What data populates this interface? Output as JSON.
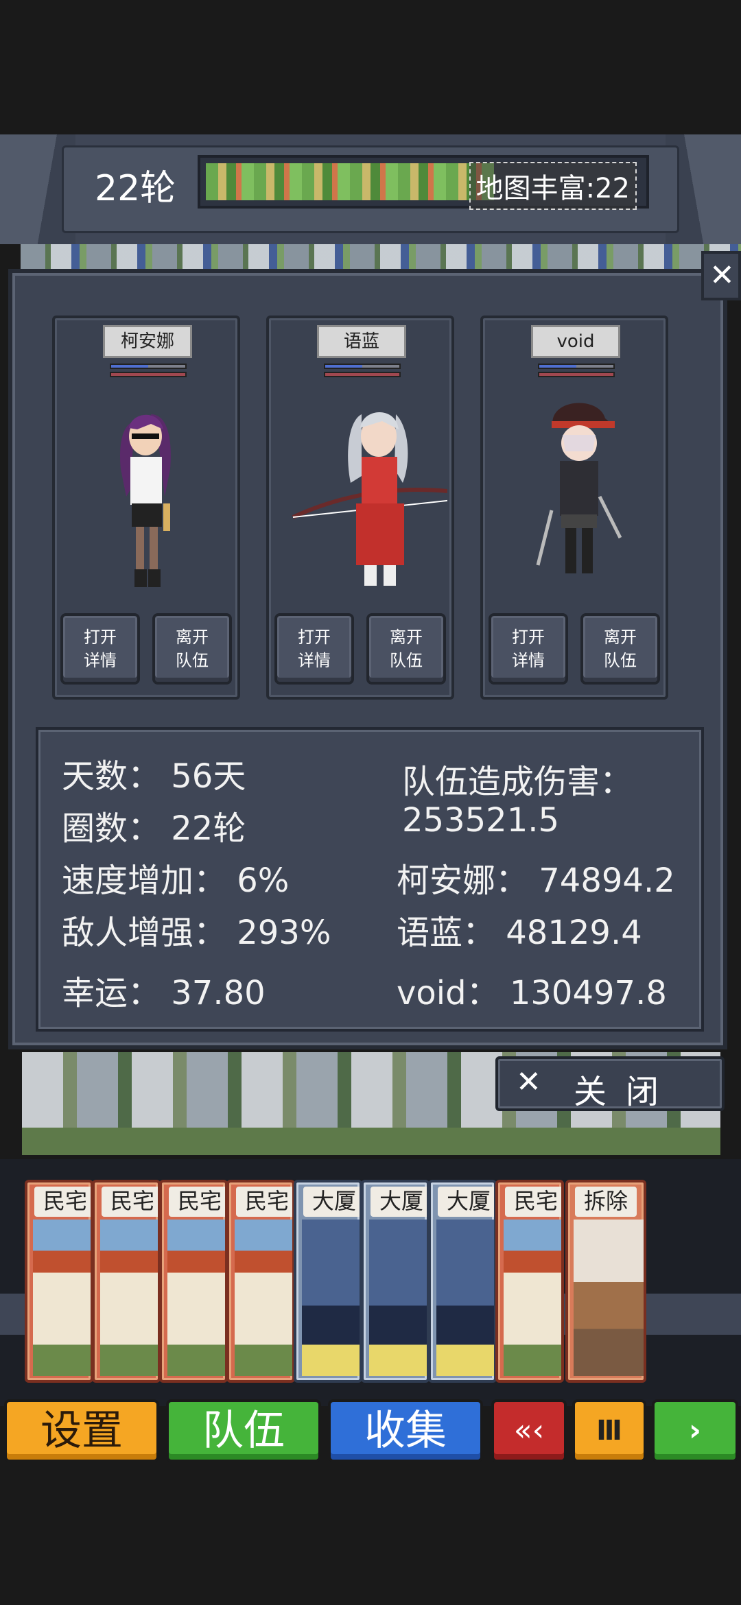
{
  "header": {
    "round": "22轮",
    "map_richness": "地图丰富:22"
  },
  "party": [
    {
      "name": "柯安娜",
      "open_details": "打开\n详情",
      "leave_team": "离开\n队伍"
    },
    {
      "name": "语蓝",
      "open_details": "打开\n详情",
      "leave_team": "离开\n队伍"
    },
    {
      "name": "void",
      "open_details": "打开\n详情",
      "leave_team": "离开\n队伍"
    }
  ],
  "stats": {
    "days": "天数：  56天",
    "laps": "圈数：  22轮",
    "speed": "速度增加：  6%",
    "enemy": "敌人增强：  293%",
    "luck": "幸运：  37.80",
    "team_damage_label": "队伍造成伤害：",
    "team_damage_value": "253521.5",
    "dmg_1": "柯安娜：  74894.2",
    "dmg_2": "语蓝：  48129.4",
    "dmg_3": "void：  130497.8"
  },
  "dialog": {
    "close_icon": "close-icon",
    "close_label": "关闭"
  },
  "cards": [
    "民宅",
    "民宅",
    "民宅",
    "民宅",
    "大厦",
    "大厦",
    "大厦",
    "民宅",
    "拆除"
  ],
  "bottom_bar": {
    "settings": "设置",
    "team": "队伍",
    "collect": "收集",
    "rewind": "«‹",
    "pause": "Ⅲ",
    "next": "›"
  },
  "colors": {
    "panel": "#3d4453",
    "settings_btn": "#f5a623",
    "team_btn": "#45b43a",
    "collect_btn": "#2f6fd8",
    "rewind_btn": "#c42c2c"
  }
}
